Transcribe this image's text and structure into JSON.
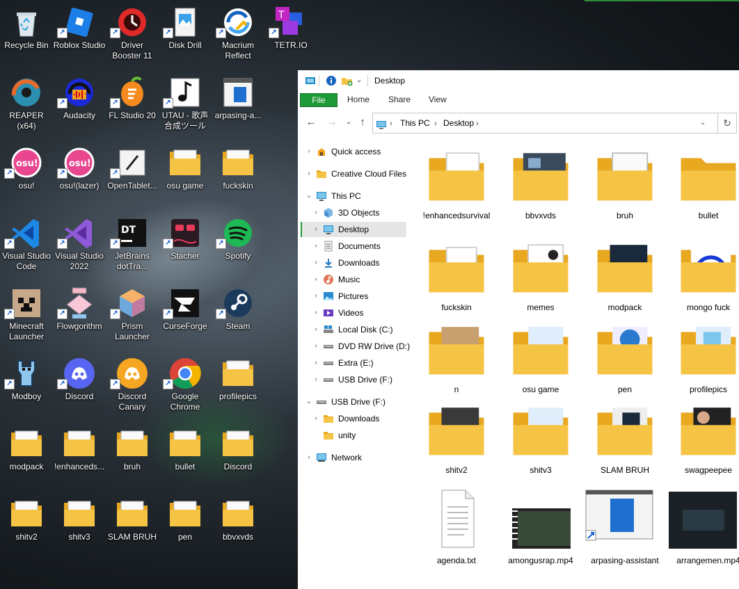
{
  "desktop": {
    "row1": [
      "Recycle Bin",
      "Roblox Studio",
      "Driver Booster 11",
      "Disk Drill",
      "Macrium Reflect",
      "TETR.IO"
    ],
    "row2": [
      "REAPER (x64)",
      "Audacity",
      "FL Studio 20",
      "UTAU - 歌声合成ツール",
      "arpasing-a..."
    ],
    "row3": [
      "osu!",
      "osu!(lazer)",
      "OpenTablet...",
      "osu game",
      "fuckskin"
    ],
    "row4": [
      "Visual Studio Code",
      "Visual Studio 2022",
      "JetBrains dotTra...",
      "Stacher",
      "Spotify"
    ],
    "row5": [
      "Minecraft Launcher",
      "Flowgorithm",
      "Prism Launcher",
      "CurseForge",
      "Steam"
    ],
    "row6": [
      "Modboy",
      "Discord",
      "Discord Canary",
      "Google Chrome",
      "profilepics"
    ],
    "row7": [
      "modpack",
      "!enhanceds...",
      "bruh",
      "bullet",
      "Discord"
    ],
    "row8": [
      "shitv2",
      "shitv3",
      "SLAM BRUH",
      "pen",
      "bbvxvds"
    ]
  },
  "explorer": {
    "title": "Desktop",
    "ribbon": {
      "file": "File",
      "home": "Home",
      "share": "Share",
      "view": "View"
    },
    "address": {
      "sep": "›",
      "part1": "This PC",
      "part2": "Desktop"
    },
    "nav": {
      "quick_access": "Quick access",
      "creative_cloud": "Creative Cloud Files",
      "this_pc": "This PC",
      "objects3d": "3D Objects",
      "desktop": "Desktop",
      "documents": "Documents",
      "downloads": "Downloads",
      "music": "Music",
      "pictures": "Pictures",
      "videos": "Videos",
      "local_disk": "Local Disk (C:)",
      "dvd": "DVD RW Drive (D:)",
      "extra": "Extra (E:)",
      "usb1": "USB Drive (F:)",
      "usb2": "USB Drive (F:)",
      "usb_downloads": "Downloads",
      "usb_unity": "unity",
      "network": "Network"
    },
    "items": [
      {
        "label": "!enhancedsurvival"
      },
      {
        "label": "bbvxvds"
      },
      {
        "label": "bruh"
      },
      {
        "label": "bullet"
      },
      {
        "label": "fuckskin"
      },
      {
        "label": "memes"
      },
      {
        "label": "modpack"
      },
      {
        "label": "mongo fuck"
      },
      {
        "label": "n"
      },
      {
        "label": "osu game"
      },
      {
        "label": "pen"
      },
      {
        "label": "profilepics"
      },
      {
        "label": "shitv2"
      },
      {
        "label": "shitv3"
      },
      {
        "label": "SLAM BRUH"
      },
      {
        "label": "swagpeepee"
      },
      {
        "label": "agenda.txt"
      },
      {
        "label": "amongusrap.mp4"
      },
      {
        "label": "arpasing-assistant"
      },
      {
        "label": "arrangemen.mp4"
      }
    ]
  },
  "colors": {
    "folder": "#f6c445",
    "folder_dark": "#e8a820",
    "accent": "#1f9a38",
    "selection": "#e5e5e5"
  }
}
